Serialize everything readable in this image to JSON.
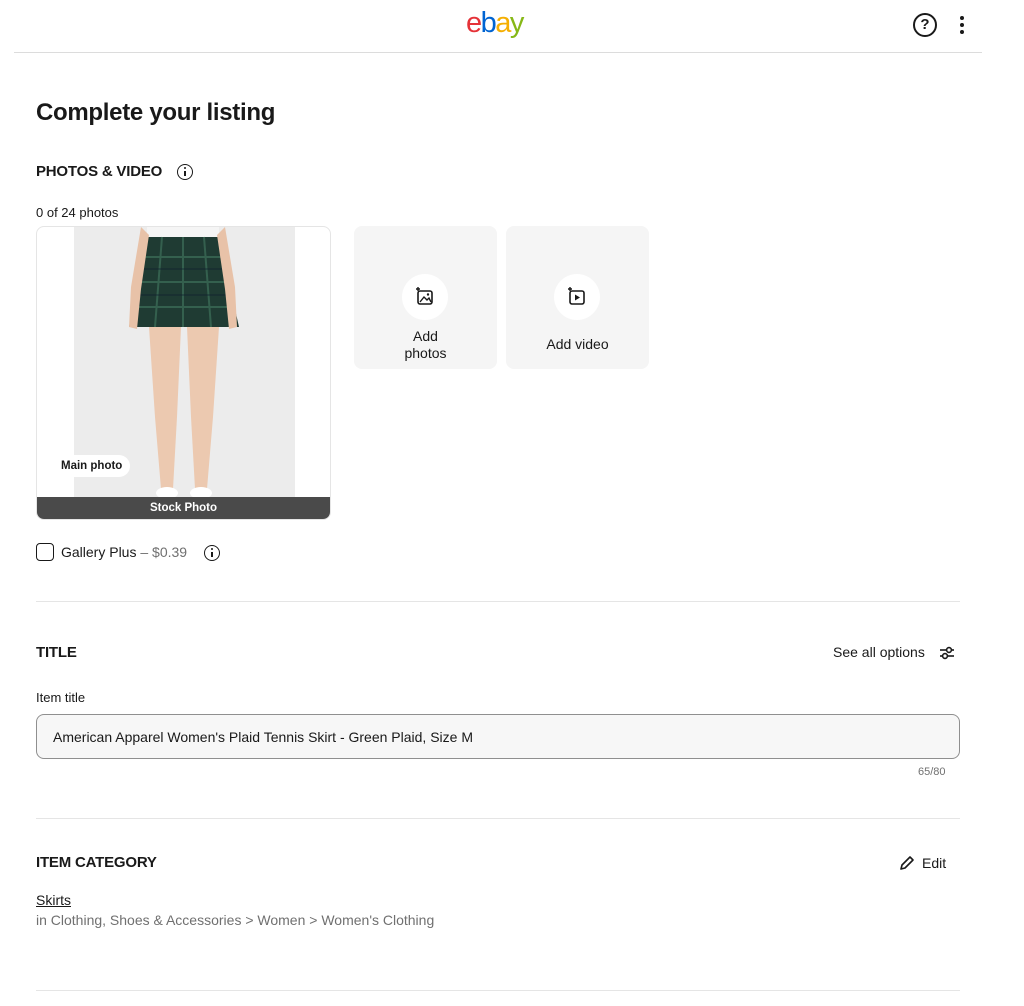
{
  "header": {
    "logo_letters": [
      "e",
      "b",
      "a",
      "y"
    ],
    "help_glyph": "?",
    "help_icon": "help-circle-icon",
    "more_icon": "more-vertical-icon"
  },
  "page_title": "Complete your listing",
  "photos": {
    "heading": "PHOTOS & VIDEO",
    "count_text": "0 of 24 photos",
    "main_badge": "Main photo",
    "stock_label": "Stock Photo",
    "add_photos_label": [
      "Add",
      "photos"
    ],
    "add_video_label": "Add video",
    "gallery_plus_label": "Gallery Plus",
    "gallery_plus_price": " – $0.39",
    "gallery_plus_checked": false
  },
  "title_section": {
    "heading": "TITLE",
    "see_all_label": "See all options",
    "field_label": "Item title",
    "value": "American Apparel Women's Plaid Tennis Skirt - Green Plaid, Size M",
    "char_count": "65/80"
  },
  "category": {
    "heading": "ITEM CATEGORY",
    "edit_label": "Edit",
    "name": "Skirts",
    "path": "in Clothing, Shoes & Accessories > Women > Women's Clothing"
  },
  "colors": {
    "accent": "#191919",
    "muted": "#707070",
    "tile_bg": "#f5f5f5",
    "logo_e": "#e53238",
    "logo_b": "#0064d2",
    "logo_a": "#f5af02",
    "logo_y": "#86b817"
  }
}
